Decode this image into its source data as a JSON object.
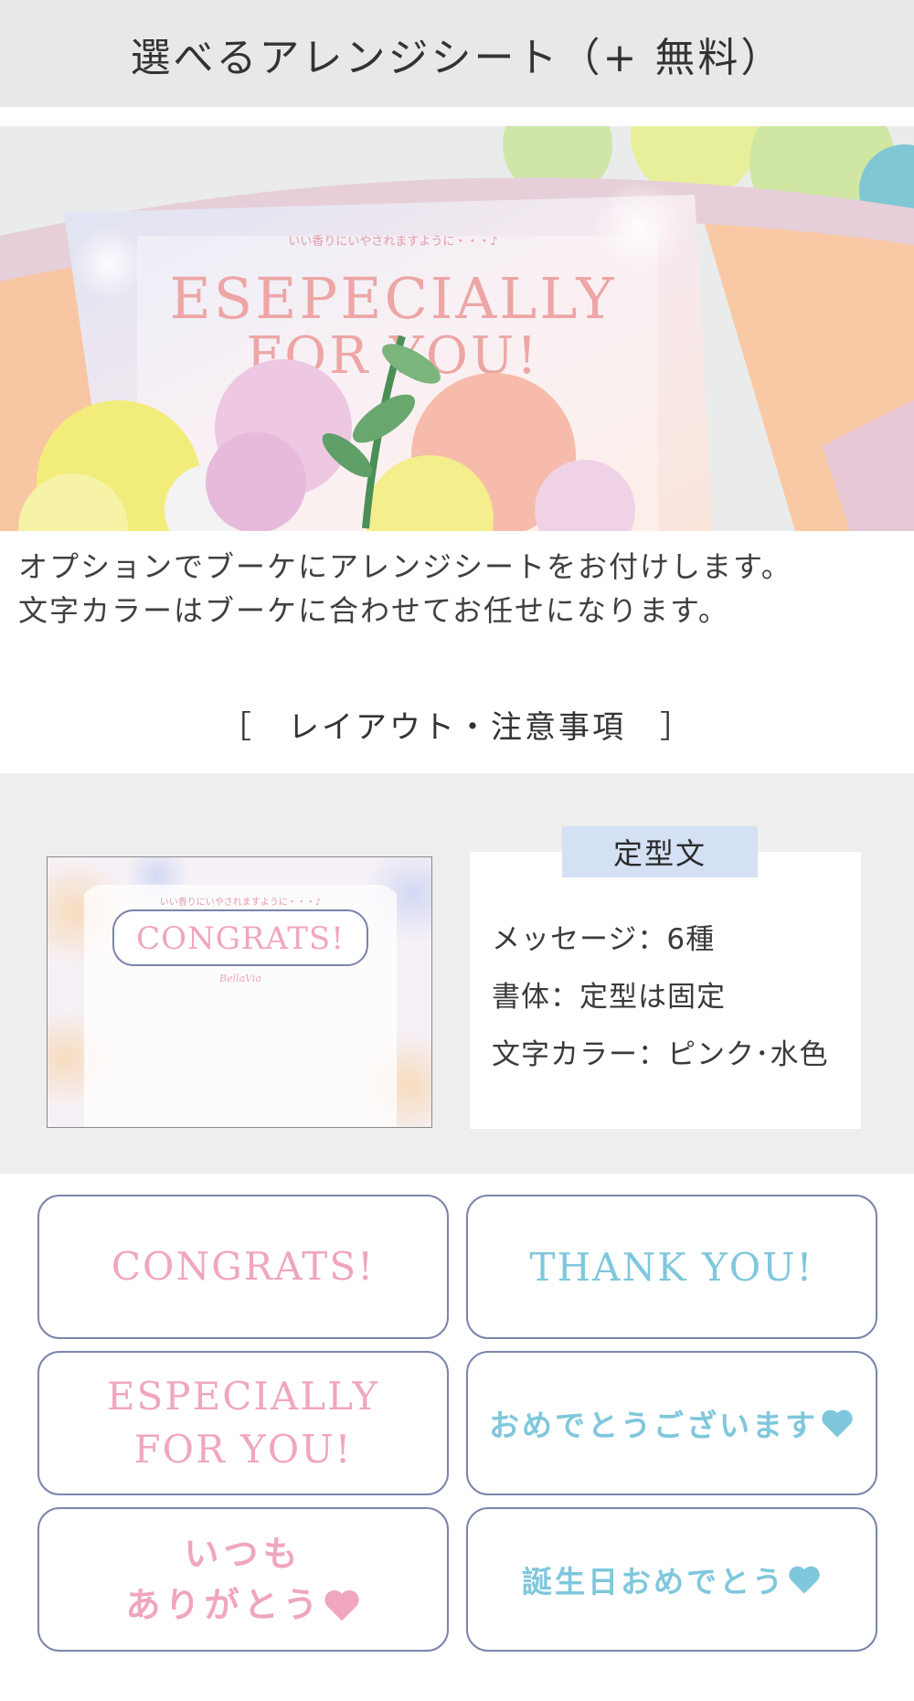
{
  "header": {
    "title": "選べるアレンジシート（+ 無料）"
  },
  "hero": {
    "card_small_text": "いい香りにいやされますように・・・♪",
    "card_line1": "ESEPECIALLY",
    "card_line2": "FOR YOU!"
  },
  "description": {
    "line1": "オプションでブーケにアレンジシートをお付けします。",
    "line2": "文字カラーはブーケに合わせてお任せになります。"
  },
  "section": {
    "title": "［　レイアウト・注意事項　］"
  },
  "preview": {
    "arc_text": "いい香りにいやされますように・・・♪",
    "message": "CONGRATS!",
    "brand": "BellaVia"
  },
  "info": {
    "tag": "定型文",
    "lines": [
      "メッセージ：6種",
      "書体：定型は固定",
      "文字カラー：ピンク･水色"
    ]
  },
  "options": [
    {
      "text": "CONGRATS!"
    },
    {
      "text": "THANK YOU!"
    },
    {
      "line1": "ESPECIALLY",
      "line2": "FOR YOU!"
    },
    {
      "text": "おめでとうございます"
    },
    {
      "line1": "いつも",
      "line2": "ありがとう"
    },
    {
      "text": "誕生日おめでとう"
    }
  ],
  "colors": {
    "pink": "#f0a6bd",
    "blue": "#7fc7dc",
    "border": "#7a84ad",
    "tag_bg": "#d4e0f3"
  },
  "icons": [
    "heart-icon"
  ]
}
